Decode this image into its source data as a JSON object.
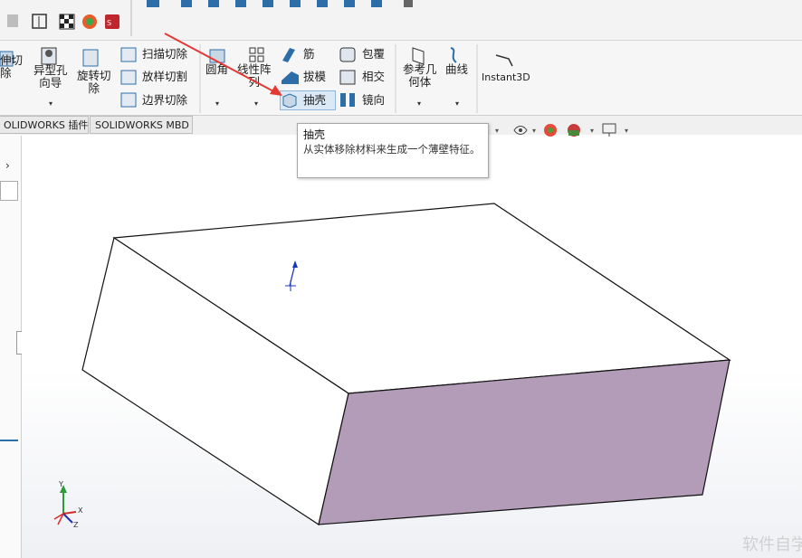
{
  "ribbon": {
    "extrude_cut": "伸切\n除",
    "hole_wizard": "异型孔\n向导",
    "revolve_cut": "旋转切\n除",
    "swept_cut": "扫描切除",
    "lofted_cut": "放样切割",
    "boundary_cut": "边界切除",
    "fillet": "圆角",
    "linear_pattern": "线性阵\n列",
    "rib": "筋",
    "draft": "拔模",
    "shell": "抽壳",
    "wrap": "包覆",
    "intersect": "相交",
    "mirror": "镜向",
    "ref_geometry": "参考几\n何体",
    "curves": "曲线",
    "instant3d": "Instant3D"
  },
  "tabs": [
    "OLIDWORKS 插件",
    "SOLIDWORKS MBD"
  ],
  "tooltip": {
    "title": "抽壳",
    "description": "从实体移除材料来生成一个薄壁特征。"
  },
  "triad": {
    "y": "Y",
    "x": "X",
    "z": "Z"
  },
  "watermark": "软件自学网",
  "colors": {
    "side_face": "#b39cb7",
    "top_face": "#ffffff",
    "annotation_arrow": "#e53935",
    "highlight": "#dbe9f7"
  }
}
